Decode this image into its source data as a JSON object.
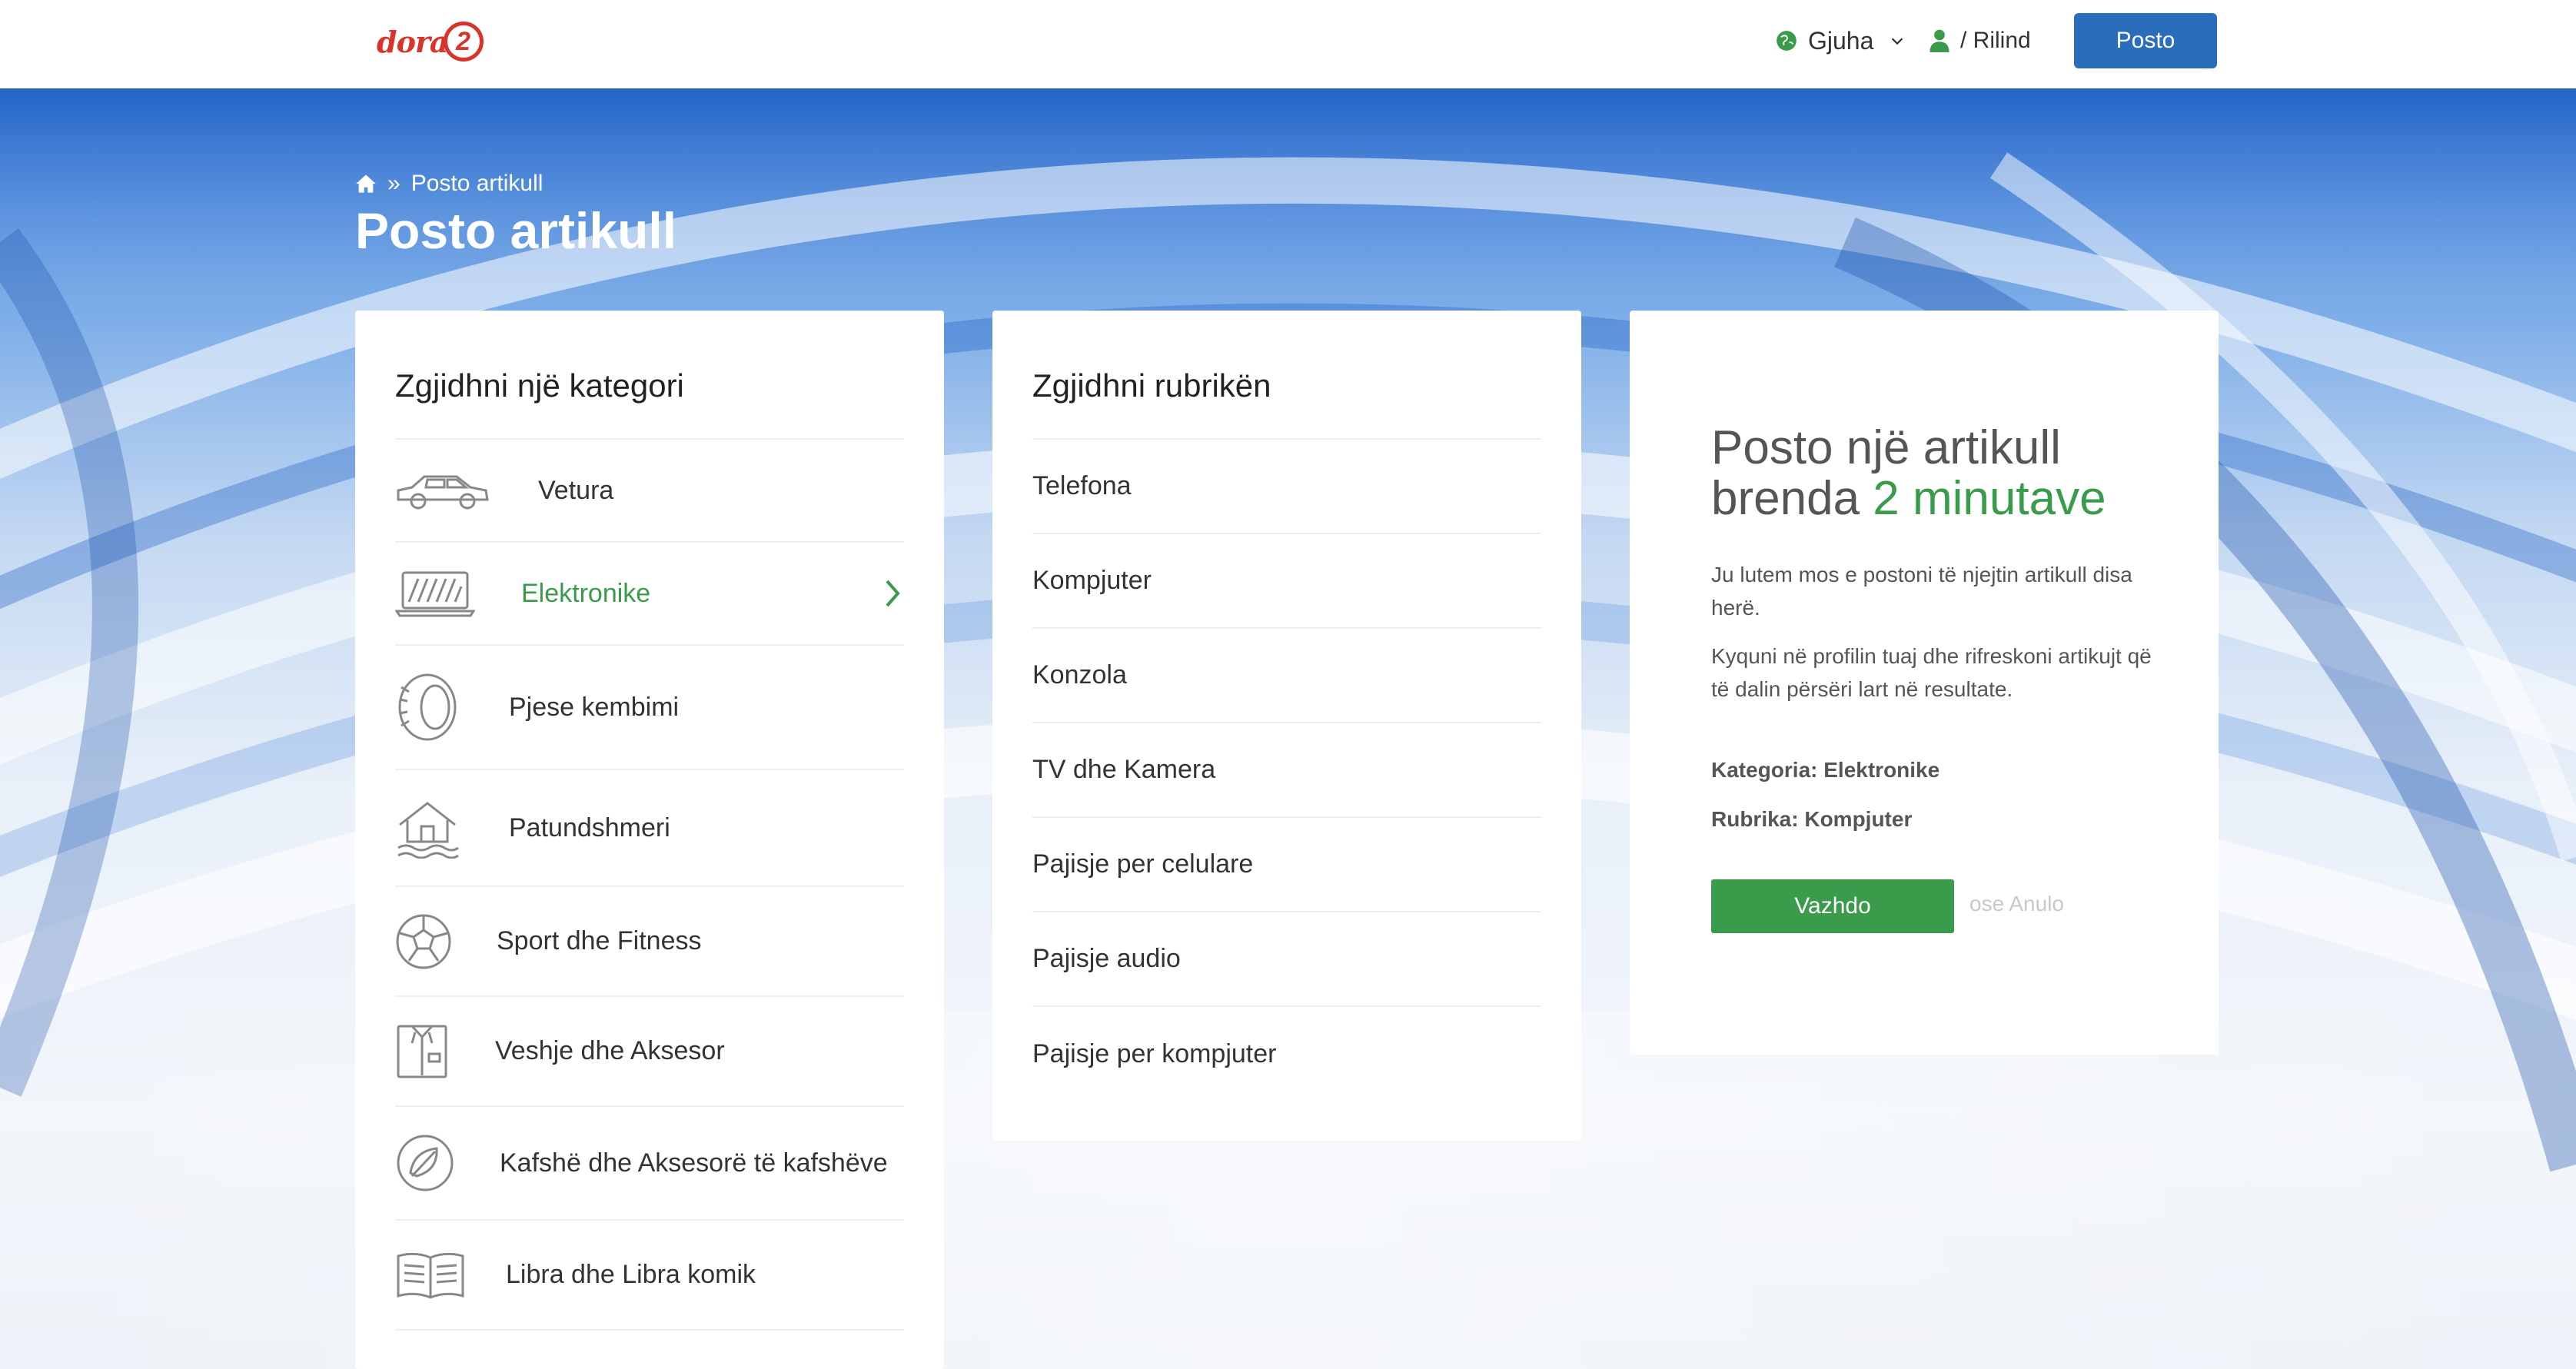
{
  "header": {
    "logo_text": "dora",
    "logo_mark": "2",
    "language_label": "Gjuha",
    "user_label": "/ Rilind",
    "post_button_label": "Posto"
  },
  "breadcrumb": {
    "current": "Posto artikull"
  },
  "page_title": "Posto artikull",
  "categories": {
    "title": "Zgjidhni një kategori",
    "items": [
      {
        "label": "Vetura",
        "icon": "car-icon"
      },
      {
        "label": "Elektronike",
        "icon": "laptop-icon",
        "active": true
      },
      {
        "label": "Pjese kembimi",
        "icon": "tire-icon"
      },
      {
        "label": "Patundshmeri",
        "icon": "house-icon"
      },
      {
        "label": "Sport dhe Fitness",
        "icon": "ball-icon"
      },
      {
        "label": "Veshje dhe Aksesor",
        "icon": "shirt-icon"
      },
      {
        "label": "Kafshë dhe Aksesorë të kafshëve",
        "icon": "pet-icon"
      },
      {
        "label": "Libra dhe Libra komik",
        "icon": "book-icon"
      }
    ]
  },
  "subcategories": {
    "title": "Zgjidhni rubrikën",
    "items": [
      "Telefona",
      "Kompjuter",
      "Konzola",
      "TV dhe Kamera",
      "Pajisje per celulare",
      "Pajisje audio",
      "Pajisje per kompjuter"
    ]
  },
  "info": {
    "heading_line1": "Posto një artikull",
    "heading_prefix": "brenda",
    "heading_highlight": "2 minutave",
    "paragraph1": "Ju lutem mos e postoni të njejtin artikull disa herë.",
    "paragraph2": "Kyquni në profilin tuaj dhe rifreskoni artikujt që të dalin përsëri lart në resultate.",
    "category_line": "Kategoria: Elektronike",
    "subcategory_line": "Rubrika: Kompjuter",
    "continue_label": "Vazhdo",
    "cancel_label": "ose Anulo"
  },
  "colors": {
    "accent_blue": "#2a6ebb",
    "accent_green": "#3a9b4a",
    "brand_red": "#d8342b"
  }
}
